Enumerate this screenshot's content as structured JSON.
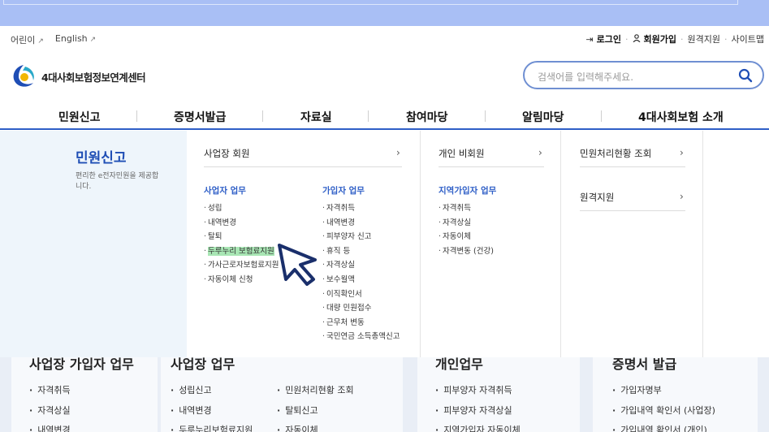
{
  "util": {
    "kids": "어린이",
    "english": "English",
    "login": "로그인",
    "join": "회원가입",
    "remote": "원격지원",
    "sitemap": "사이트맵",
    "sep": "·"
  },
  "brand": {
    "name": "4대사회보험정보연계센터"
  },
  "search": {
    "placeholder": "검색어를 입력해주세요."
  },
  "gnb": [
    "민원신고",
    "증명서발급",
    "자료실",
    "참여마당",
    "알림마당",
    "4대사회보험 소개"
  ],
  "mega": {
    "title": "민원신고",
    "desc": "편리한 e전자민원을 제공합니다.",
    "col1_head": "사업장 회원",
    "col2_head": "개인 비회원",
    "col3_items": [
      "민원처리현황 조회",
      "원격지원"
    ],
    "employer": {
      "title": "사업자 업무",
      "items": [
        "성립",
        "내역변경",
        "탈퇴",
        "두루누리 보험료지원",
        "가사근로자보험료지원",
        "자동이체 신청"
      ]
    },
    "subscriber": {
      "title": "가입자 업무",
      "items": [
        "자격취득",
        "내역변경",
        "피부양자 신고",
        "휴직 등",
        "자격상실",
        "보수월액",
        "이직확인서",
        "대량 민원접수",
        "근무처 변동",
        "국민연금 소득총액신고"
      ]
    },
    "regional": {
      "title": "지역가입자 업무",
      "items": [
        "자격취득",
        "자격상실",
        "자동이체",
        "자격변동 (건강)"
      ]
    }
  },
  "bottom": {
    "s1": {
      "title": "사업장 가입자 업무",
      "items": [
        "자격취득",
        "자격상실",
        "내역변경"
      ]
    },
    "s2": {
      "title": "사업장 업무",
      "items": [
        "성립신고",
        "내역변경",
        "두루누리보험료지원"
      ]
    },
    "s2b": {
      "items": [
        "민원처리현황 조회",
        "탈퇴신고",
        "자동이체"
      ]
    },
    "s3": {
      "title": "개인업무",
      "items": [
        "피부양자 자격취득",
        "피부양자 자격상실",
        "지역가입자 자동이체"
      ]
    },
    "s4": {
      "title": "증명서 발급",
      "items": [
        "가입자명부",
        "가입내역 확인서 (사업장)",
        "가입내역 확인서 (개인)"
      ]
    }
  },
  "colors": {
    "accent": "#2f5fc7",
    "topband": "#a9bff5",
    "highlight": "#a8e6b4"
  }
}
